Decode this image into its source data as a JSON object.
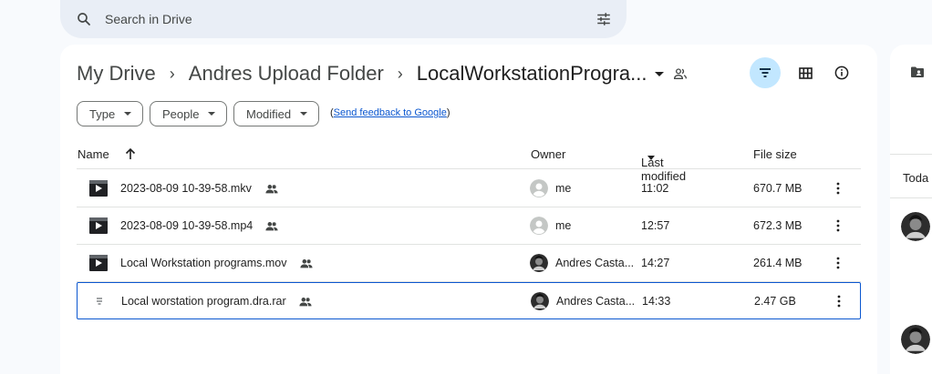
{
  "search": {
    "placeholder": "Search in Drive"
  },
  "breadcrumb": {
    "items": [
      "My Drive",
      "Andres Upload Folder"
    ],
    "separator": "›",
    "current": "LocalWorkstationProgra..."
  },
  "filters": {
    "chips": [
      "Type",
      "People",
      "Modified"
    ],
    "feedback_prefix": "(",
    "feedback_link": "Send feedback to Google",
    "feedback_suffix": ")"
  },
  "table": {
    "headers": {
      "name": "Name",
      "owner": "Owner",
      "modified": "Last modified",
      "size": "File size"
    },
    "rows": [
      {
        "name": "2023-08-09 10-39-58.mkv",
        "owner": "me",
        "modified": "11:02",
        "size": "670.7 MB",
        "type": "video"
      },
      {
        "name": "2023-08-09 10-39-58.mp4",
        "owner": "me",
        "modified": "12:57",
        "size": "672.3 MB",
        "type": "video"
      },
      {
        "name": "Local Workstation programs.mov",
        "owner": "Andres Casta...",
        "modified": "14:27",
        "size": "261.4 MB",
        "type": "video"
      },
      {
        "name": "Local worstation program.dra.rar",
        "owner": "Andres Casta...",
        "modified": "14:33",
        "size": "2.47 GB",
        "type": "archive"
      }
    ]
  },
  "right_panel": {
    "today": "Toda"
  },
  "colors": {
    "accent": "#0b57d0",
    "selected_chip": "#c2e7ff",
    "page_bg": "#f8fafd",
    "search_bg": "#e9eef6"
  }
}
